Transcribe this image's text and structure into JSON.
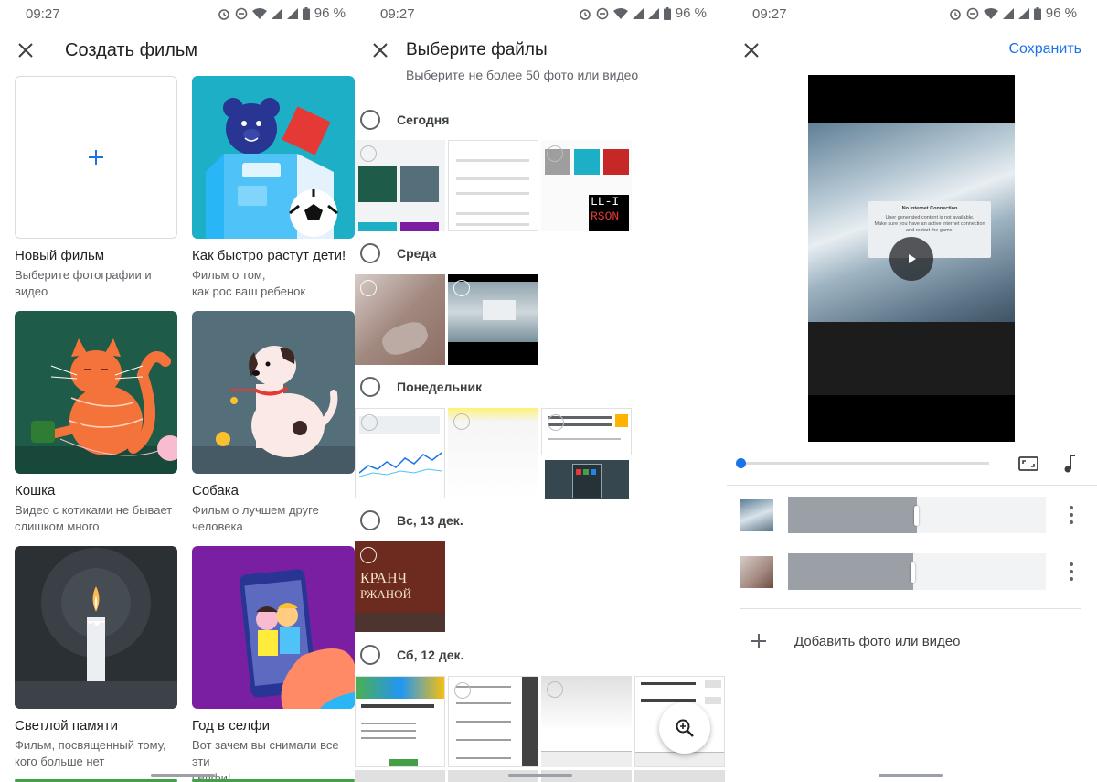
{
  "status": {
    "time": "09:27",
    "battery": "96 %",
    "icons": [
      "alarm-icon",
      "dnd-icon",
      "wifi-icon",
      "signal-icon",
      "signal-icon",
      "battery-icon"
    ]
  },
  "create_movie": {
    "title": "Создать фильм",
    "cards": [
      {
        "name": "Новый фильм",
        "desc": "Выберите фотографии и\nвидео"
      },
      {
        "name": "Как быстро растут дети!",
        "desc": "Фильм о том,\n как рос ваш ребенок"
      },
      {
        "name": "Кошка",
        "desc": "Видео с котиками не бывает\nслишком много"
      },
      {
        "name": "Собака",
        "desc": "Фильм о лучшем друге\nчеловека"
      },
      {
        "name": "Светлой памяти",
        "desc": "Фильм, посвященный тому,\nкого больше нет"
      },
      {
        "name": "Год в селфи",
        "desc": "Вот зачем вы снимали все эти\nселфи!"
      }
    ]
  },
  "select_files": {
    "title": "Выберите файлы",
    "subtitle": "Выберите не более 50 фото или видео",
    "sections": [
      {
        "label": "Сегодня"
      },
      {
        "label": "Среда"
      },
      {
        "label": "Понедельник"
      },
      {
        "label": "Вс, 13 дек."
      },
      {
        "label": "Сб, 12 дек."
      }
    ],
    "thumb_texts": {
      "book_title": "КРАНЧ",
      "book_sub": "РЖАНОЙ",
      "dialog_title": "No Internet Connection",
      "game_text": "LL-I",
      "game_sub": "RSON"
    }
  },
  "editor": {
    "save_label": "Сохранить",
    "add_label": "Добавить фото или видео",
    "dialog_title": "No Internet Connection",
    "dialog_text": "User generated content is not available.\nMake sure you have an active internet connection\nand restart the game.",
    "clips": [
      {
        "fill_fraction": 0.5
      },
      {
        "fill_fraction": 0.485
      }
    ],
    "seek_position": 0.0
  },
  "colors": {
    "accent": "#1a73e8",
    "teal": "#1dafc6",
    "green": "#1e5b48",
    "slate": "#546e7a",
    "dark": "#2b3034",
    "purple": "#7b1fa2"
  }
}
